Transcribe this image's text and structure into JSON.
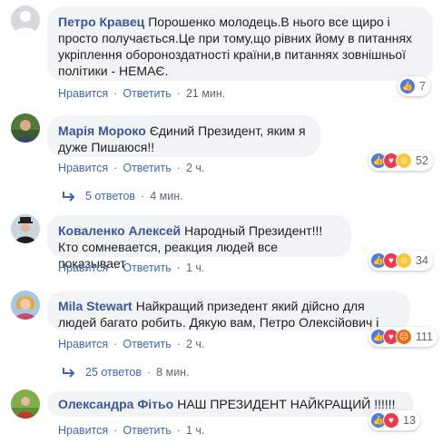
{
  "ui": {
    "like": "Нравится",
    "reply": "Ответить",
    "sep": "·"
  },
  "comments": [
    {
      "author": "Петро Кравец",
      "text": "Порошенко молодець.В нього все щиро і просто получається.Це при тому,що рівних йому в питаннях укріплення обороноздатності країни,в питаннях зовнішньої політики - НЕМАЄ.",
      "time": "21 мин.",
      "reactions": [
        "like"
      ],
      "count": "7"
    },
    {
      "author": "Марія Мороко",
      "text": "Єдиний Президент, яким я дуже Пишаюся!!",
      "time": "2 ч.",
      "reactions": [
        "like",
        "love",
        "haha"
      ],
      "count": "52",
      "replies": {
        "label": "5 ответов",
        "time": "4 мин."
      }
    },
    {
      "author": "Коваленко Алексей",
      "text": "Народный Президент!!! Кто сомневается, реакция людей все показывает",
      "time": "1 ч.",
      "reactions": [
        "like",
        "love",
        "haha"
      ],
      "count": "34"
    },
    {
      "author": "Mila Stewart",
      "text": "Найкращий призедент який дійсно для людей багато робить. Дякую вам, Петро Олексійович і",
      "time": "2 ч.",
      "reactions": [
        "like",
        "love",
        "angry"
      ],
      "count": "111",
      "replies": {
        "label": "25 ответов",
        "time": "8 мин."
      }
    },
    {
      "author": "Олександра Фітьо",
      "text": "НАШ ПРЕЗИДЕНТ НАЙКРАЩИЙ !!!!!!",
      "time": "1 ч.",
      "reactions": [
        "like",
        "love"
      ],
      "count": "13"
    }
  ],
  "colors": {
    "accent": "#4267b2",
    "author": "#385898",
    "bubble": "#f2f3f5"
  }
}
